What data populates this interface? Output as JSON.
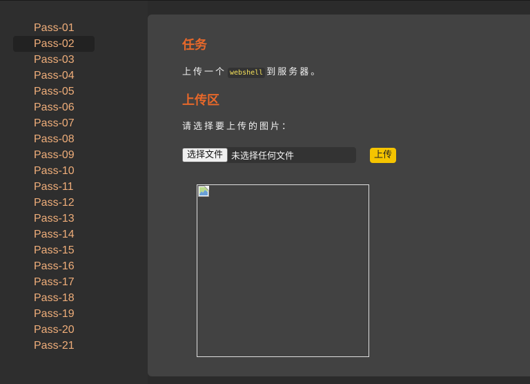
{
  "sidebar": {
    "items": [
      {
        "label": "Pass-01"
      },
      {
        "label": "Pass-02"
      },
      {
        "label": "Pass-03"
      },
      {
        "label": "Pass-04"
      },
      {
        "label": "Pass-05"
      },
      {
        "label": "Pass-06"
      },
      {
        "label": "Pass-07"
      },
      {
        "label": "Pass-08"
      },
      {
        "label": "Pass-09"
      },
      {
        "label": "Pass-10"
      },
      {
        "label": "Pass-11"
      },
      {
        "label": "Pass-12"
      },
      {
        "label": "Pass-13"
      },
      {
        "label": "Pass-14"
      },
      {
        "label": "Pass-15"
      },
      {
        "label": "Pass-16"
      },
      {
        "label": "Pass-17"
      },
      {
        "label": "Pass-18"
      },
      {
        "label": "Pass-19"
      },
      {
        "label": "Pass-20"
      },
      {
        "label": "Pass-21"
      }
    ],
    "active_label": "Pass-02"
  },
  "task": {
    "title": "任务",
    "desc_before": "上传一个",
    "desc_code": "webshell",
    "desc_after": "到服务器。"
  },
  "upload": {
    "title": "上传区",
    "prompt": "请选择要上传的图片：",
    "choose_button": "选择文件",
    "file_status": "未选择任何文件",
    "submit_button": "上传"
  },
  "preview": {
    "icon": "broken-image-icon"
  },
  "colors": {
    "accent": "#e8682a",
    "link": "#f0ae7a",
    "button": "#f5c400",
    "code": "#f5e15a"
  }
}
